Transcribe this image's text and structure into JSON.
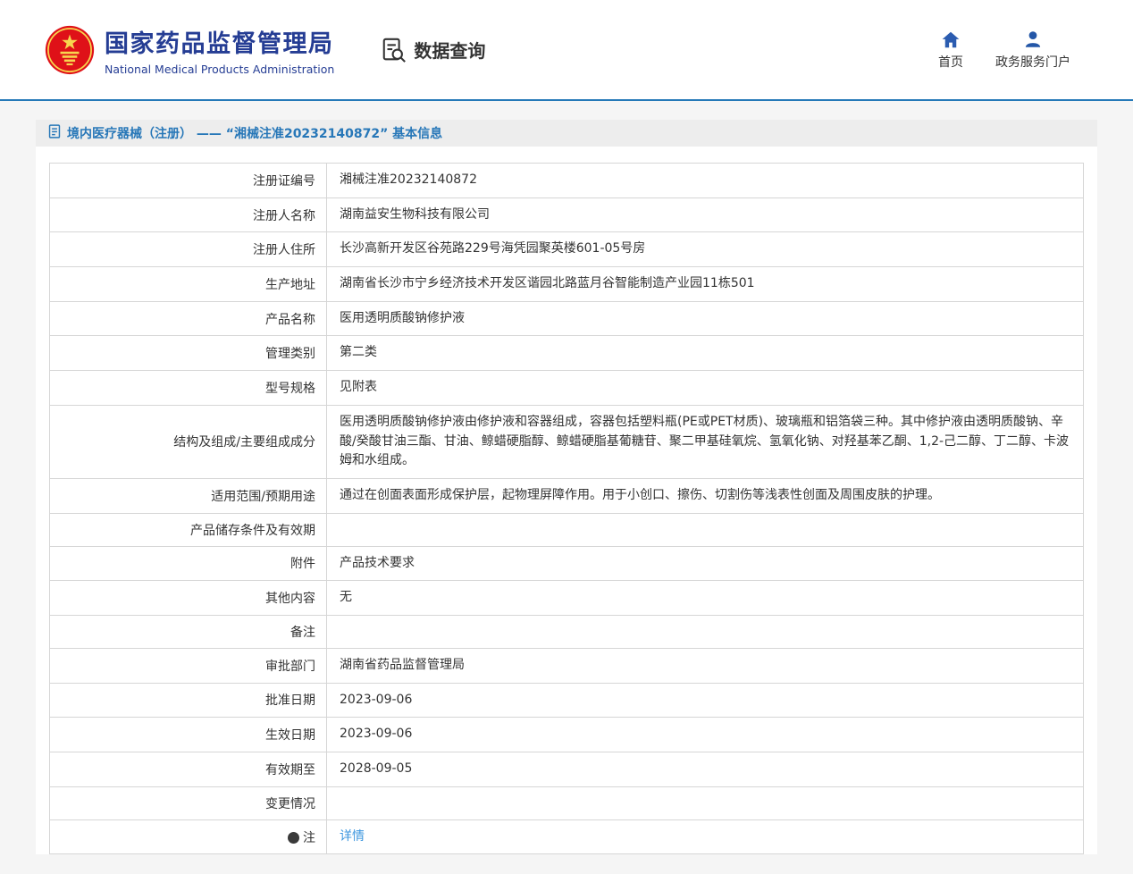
{
  "header": {
    "org_name_cn": "国家药品监督管理局",
    "org_name_en": "National Medical Products Administration",
    "section_title": "数据查询",
    "nav_home": "首页",
    "nav_portal": "政务服务门户"
  },
  "title_bar": {
    "text": "境内医疗器械（注册） —— “湘械注准20232140872” 基本信息"
  },
  "colors": {
    "brand_blue": "#253d94",
    "divider_blue": "#2579b8",
    "title_blue": "#2777b8",
    "link_blue": "#3e97df",
    "emblem_red": "#df1118",
    "emblem_gold": "#f7d54e"
  },
  "table": {
    "rows": [
      {
        "label": "注册证编号",
        "value": "湘械注准20232140872"
      },
      {
        "label": "注册人名称",
        "value": "湖南益安生物科技有限公司"
      },
      {
        "label": "注册人住所",
        "value": "长沙高新开发区谷苑路229号海凭园聚英楼601-05号房"
      },
      {
        "label": "生产地址",
        "value": "湖南省长沙市宁乡经济技术开发区谐园北路蓝月谷智能制造产业园11栋501"
      },
      {
        "label": "产品名称",
        "value": "医用透明质酸钠修护液"
      },
      {
        "label": "管理类别",
        "value": "第二类"
      },
      {
        "label": "型号规格",
        "value": "见附表"
      },
      {
        "label": "结构及组成/主要组成成分",
        "value": "医用透明质酸钠修护液由修护液和容器组成，容器包括塑料瓶(PE或PET材质)、玻璃瓶和铝箔袋三种。其中修护液由透明质酸钠、辛酸/癸酸甘油三酯、甘油、鲸蜡硬脂醇、鲸蜡硬脂基葡糖苷、聚二甲基硅氧烷、氢氧化钠、对羟基苯乙酮、1,2-己二醇、丁二醇、卡波姆和水组成。"
      },
      {
        "label": "适用范围/预期用途",
        "value": "通过在创面表面形成保护层，起物理屏障作用。用于小创口、擦伤、切割伤等浅表性创面及周围皮肤的护理。"
      },
      {
        "label": "产品储存条件及有效期",
        "value": ""
      },
      {
        "label": "附件",
        "value": "产品技术要求"
      },
      {
        "label": "其他内容",
        "value": "无"
      },
      {
        "label": "备注",
        "value": ""
      },
      {
        "label": "审批部门",
        "value": "湖南省药品监督管理局"
      },
      {
        "label": "批准日期",
        "value": "2023-09-06"
      },
      {
        "label": "生效日期",
        "value": "2023-09-06"
      },
      {
        "label": "有效期至",
        "value": "2028-09-05"
      },
      {
        "label": "变更情况",
        "value": ""
      },
      {
        "label": "注",
        "value": "详情",
        "link": true,
        "icon": "note-icon"
      }
    ]
  }
}
